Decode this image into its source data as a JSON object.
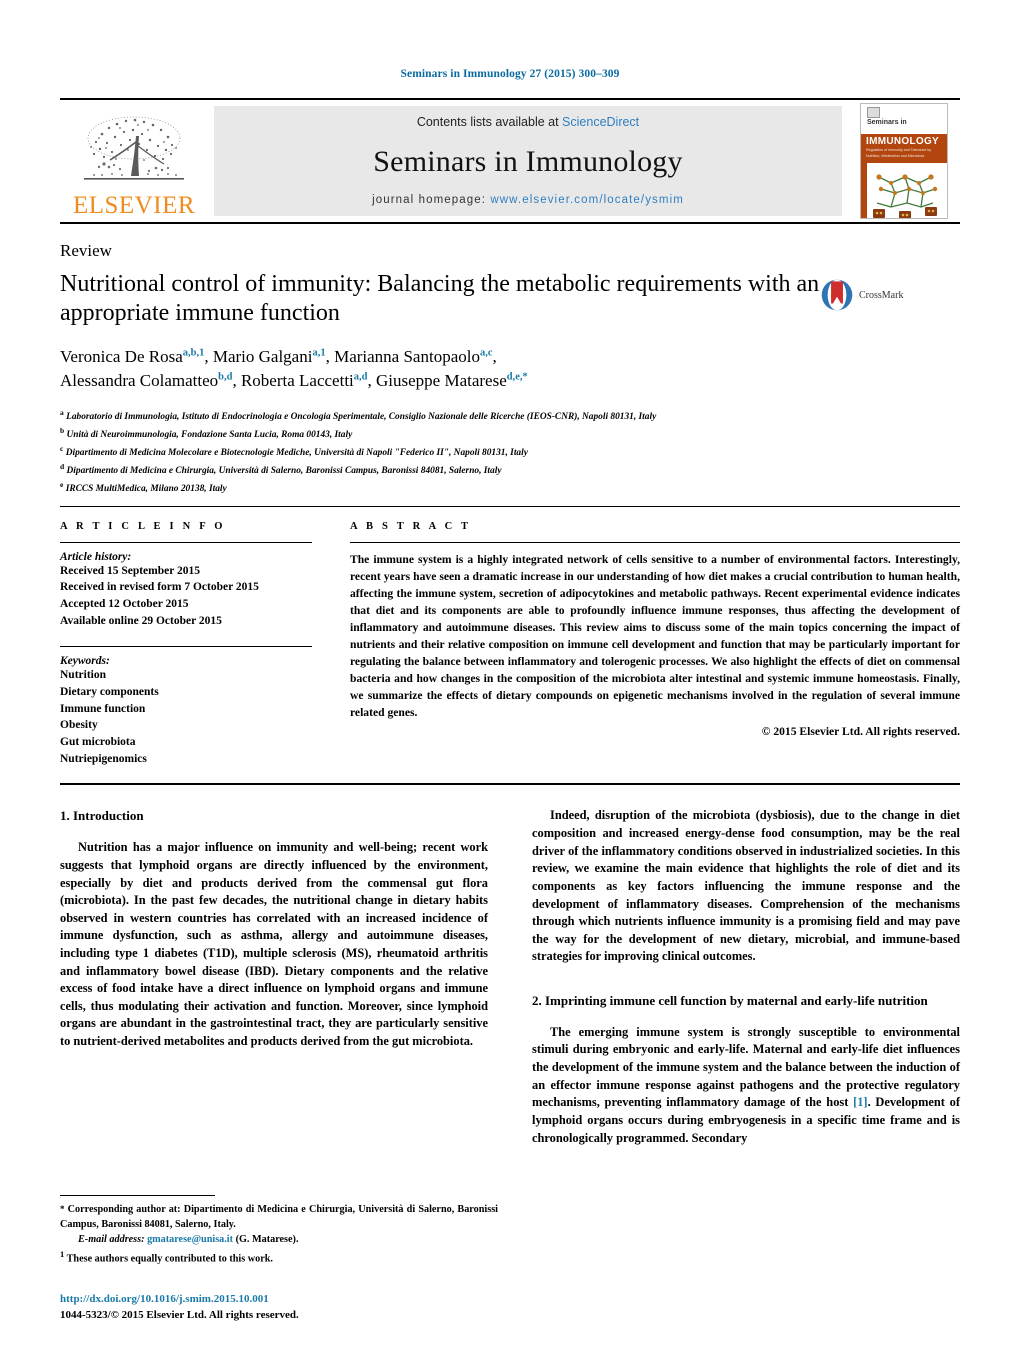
{
  "running_head": "Seminars in Immunology 27 (2015) 300–309",
  "masthead": {
    "publisher_logo_label": "ELSEVIER",
    "contents_prefix": "Contents lists available at ",
    "contents_link": "ScienceDirect",
    "journal_name": "Seminars in Immunology",
    "homepage_prefix": "journal homepage: ",
    "homepage_url": "www.elsevier.com/locate/ysmim",
    "cover": {
      "top_label": "Seminars in",
      "band_title": "IMMUNOLOGY",
      "band_sub_line1": "Regulation of Immunity and Tolerance by",
      "band_sub_line2": "Nutrition, Metabolism and Microbiota"
    }
  },
  "article": {
    "type": "Review",
    "title": "Nutritional control of immunity: Balancing the metabolic requirements with an appropriate immune function",
    "crossmark_label": "CrossMark",
    "authors": [
      {
        "name": "Veronica De Rosa",
        "sup": "a,b,1",
        "sep": ", "
      },
      {
        "name": "Mario Galgani",
        "sup": "a,1",
        "sep": ", "
      },
      {
        "name": "Marianna Santopaolo",
        "sup": "a,c",
        "sep": ","
      },
      {
        "name": "Alessandra Colamatteo",
        "sup": "b,d",
        "sep": ", "
      },
      {
        "name": "Roberta Laccetti",
        "sup": "a,d",
        "sep": ", "
      },
      {
        "name": "Giuseppe Matarese",
        "sup": "d,e,*",
        "sep": ""
      }
    ],
    "affiliations": [
      {
        "mark": "a",
        "text": "Laboratorio di Immunologia, Istituto di Endocrinologia e Oncologia Sperimentale, Consiglio Nazionale delle Ricerche (IEOS-CNR), Napoli 80131, Italy"
      },
      {
        "mark": "b",
        "text": "Unità di Neuroimmunologia, Fondazione Santa Lucia, Roma 00143, Italy"
      },
      {
        "mark": "c",
        "text": "Dipartimento di Medicina Molecolare e Biotecnologie Mediche, Università di Napoli \"Federico II\", Napoli 80131, Italy"
      },
      {
        "mark": "d",
        "text": "Dipartimento di Medicina e Chirurgia, Università di Salerno, Baronissi Campus, Baronissi 84081, Salerno, Italy"
      },
      {
        "mark": "e",
        "text": "IRCCS MultiMedica, Milano 20138, Italy"
      }
    ]
  },
  "article_info": {
    "heading": "A R T I C L E    I N F O",
    "history_label": "Article history:",
    "history": [
      "Received 15 September 2015",
      "Received in revised form 7 October 2015",
      "Accepted 12 October 2015",
      "Available online 29 October 2015"
    ],
    "keywords_label": "Keywords:",
    "keywords": [
      "Nutrition",
      "Dietary components",
      "Immune function",
      "Obesity",
      "Gut microbiota",
      "Nutriepigenomics"
    ]
  },
  "abstract": {
    "heading": "A B S T R A C T",
    "text": "The immune system is a highly integrated network of cells sensitive to a number of environmental factors. Interestingly, recent years have seen a dramatic increase in our understanding of how diet makes a crucial contribution to human health, affecting the immune system, secretion of adipocytokines and metabolic pathways. Recent experimental evidence indicates that diet and its components are able to profoundly influence immune responses, thus affecting the development of inflammatory and autoimmune diseases. This review aims to discuss some of the main topics concerning the impact of nutrients and their relative composition on immune cell development and function that may be particularly important for regulating the balance between inflammatory and tolerogenic processes. We also highlight the effects of diet on commensal bacteria and how changes in the composition of the microbiota alter intestinal and systemic immune homeostasis. Finally, we summarize the effects of dietary compounds on epigenetic mechanisms involved in the regulation of several immune related genes.",
    "copyright": "© 2015 Elsevier Ltd. All rights reserved."
  },
  "body": {
    "left": {
      "section1_heading": "1.  Introduction",
      "section1_para1": "Nutrition has a major influence on immunity and well-being; recent work suggests that lymphoid organs are directly influenced by the environment, especially by diet and products derived from the commensal gut flora (microbiota). In the past few decades, the nutritional change in dietary habits observed in western countries has correlated with an increased incidence of immune dysfunction, such as asthma, allergy and autoimmune diseases, including type 1 diabetes (T1D), multiple sclerosis (MS), rheumatoid arthritis and inflammatory bowel disease (IBD). Dietary components and the relative excess of food intake have a direct influence on lymphoid organs and immune cells, thus modulating their activation and function. Moreover, since lymphoid organs are abundant in the gastrointestinal tract, they are particularly sensitive to nutrient-derived metabolites and products derived from the gut microbiota."
    },
    "right": {
      "para1": "Indeed, disruption of the microbiota (dysbiosis), due to the change in diet composition and increased energy-dense food consumption, may be the real driver of the inflammatory conditions observed in industrialized societies. In this review, we examine the main evidence that highlights the role of diet and its components as key factors influencing the immune response and the development of inflammatory diseases. Comprehension of the mechanisms through which nutrients influence immunity is a promising field and may pave the way for the development of new dietary, microbial, and immune-based strategies for improving clinical outcomes.",
      "section2_heading": "2.  Imprinting immune cell function by maternal and early-life nutrition",
      "section2_para1_a": "The emerging immune system is strongly susceptible to environmental stimuli during embryonic and early-life. Maternal and early-life diet influences the development of the immune system and the balance between the induction of an effector immune response against pathogens and the protective regulatory mechanisms, preventing inflammatory damage of the host ",
      "section2_ref": "[1]",
      "section2_para1_b": ". Development of lymphoid organs occurs during embryogenesis in a specific time frame and is chronologically programmed. Secondary"
    }
  },
  "footnotes": {
    "corresponding_mark": "*",
    "corresponding": "Corresponding author at: Dipartimento di Medicina e Chirurgia, Università di Salerno, Baronissi Campus, Baronissi 84081, Salerno, Italy.",
    "email_label": "E-mail address:",
    "email": "gmatarese@unisa.it",
    "email_suffix": "(G. Matarese).",
    "equal_mark": "1",
    "equal_contrib": "These authors equally contributed to this work."
  },
  "footer": {
    "doi": "http://dx.doi.org/10.1016/j.smim.2015.10.001",
    "issn_line": "1044-5323/© 2015 Elsevier Ltd. All rights reserved."
  },
  "colors": {
    "link_blue": "#1a7aa8",
    "sd_blue": "#2f7fc1",
    "elsevier_orange": "#F08B1D",
    "cover_rust": "#B3450F",
    "masthead_gray": "#e8e8e8"
  }
}
